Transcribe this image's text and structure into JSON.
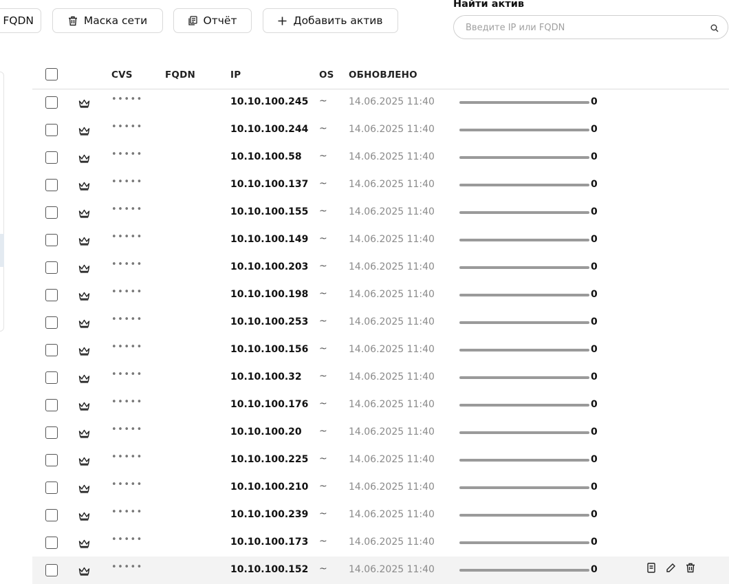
{
  "toolbar": {
    "fqdn_label": "FQDN",
    "mask_label": "Маска сети",
    "report_label": "Отчёт",
    "add_label": "Добавить актив"
  },
  "search": {
    "title": "Найти актив",
    "placeholder": "Введите IP или FQDN"
  },
  "table": {
    "headers": {
      "cvs": "CVS",
      "fqdn": "FQDN",
      "ip": "IP",
      "os": "OS",
      "updated": "ОБНОВЛЕНО"
    },
    "rows": [
      {
        "cvs": "•••••",
        "ip": "10.10.100.245",
        "os": "~",
        "updated": "14.06.2025 11:40",
        "score": "0"
      },
      {
        "cvs": "•••••",
        "ip": "10.10.100.244",
        "os": "~",
        "updated": "14.06.2025 11:40",
        "score": "0"
      },
      {
        "cvs": "•••••",
        "ip": "10.10.100.58",
        "os": "~",
        "updated": "14.06.2025 11:40",
        "score": "0"
      },
      {
        "cvs": "•••••",
        "ip": "10.10.100.137",
        "os": "~",
        "updated": "14.06.2025 11:40",
        "score": "0"
      },
      {
        "cvs": "•••••",
        "ip": "10.10.100.155",
        "os": "~",
        "updated": "14.06.2025 11:40",
        "score": "0"
      },
      {
        "cvs": "•••••",
        "ip": "10.10.100.149",
        "os": "~",
        "updated": "14.06.2025 11:40",
        "score": "0"
      },
      {
        "cvs": "•••••",
        "ip": "10.10.100.203",
        "os": "~",
        "updated": "14.06.2025 11:40",
        "score": "0"
      },
      {
        "cvs": "•••••",
        "ip": "10.10.100.198",
        "os": "~",
        "updated": "14.06.2025 11:40",
        "score": "0"
      },
      {
        "cvs": "•••••",
        "ip": "10.10.100.253",
        "os": "~",
        "updated": "14.06.2025 11:40",
        "score": "0"
      },
      {
        "cvs": "•••••",
        "ip": "10.10.100.156",
        "os": "~",
        "updated": "14.06.2025 11:40",
        "score": "0"
      },
      {
        "cvs": "•••••",
        "ip": "10.10.100.32",
        "os": "~",
        "updated": "14.06.2025 11:40",
        "score": "0"
      },
      {
        "cvs": "•••••",
        "ip": "10.10.100.176",
        "os": "~",
        "updated": "14.06.2025 11:40",
        "score": "0"
      },
      {
        "cvs": "•••••",
        "ip": "10.10.100.20",
        "os": "~",
        "updated": "14.06.2025 11:40",
        "score": "0"
      },
      {
        "cvs": "•••••",
        "ip": "10.10.100.225",
        "os": "~",
        "updated": "14.06.2025 11:40",
        "score": "0"
      },
      {
        "cvs": "•••••",
        "ip": "10.10.100.210",
        "os": "~",
        "updated": "14.06.2025 11:40",
        "score": "0"
      },
      {
        "cvs": "•••••",
        "ip": "10.10.100.239",
        "os": "~",
        "updated": "14.06.2025 11:40",
        "score": "0"
      },
      {
        "cvs": "•••••",
        "ip": "10.10.100.173",
        "os": "~",
        "updated": "14.06.2025 11:40",
        "score": "0"
      },
      {
        "cvs": "•••••",
        "ip": "10.10.100.152",
        "os": "~",
        "updated": "14.06.2025 11:40",
        "score": "0",
        "hover": true
      }
    ]
  },
  "icons": {
    "row_status": "crown-icon",
    "search": "search-icon",
    "mask": "trash-icon",
    "report": "report-icon",
    "add": "plus-icon",
    "row_actions": [
      "document-icon",
      "pencil-icon",
      "trash-icon"
    ]
  }
}
